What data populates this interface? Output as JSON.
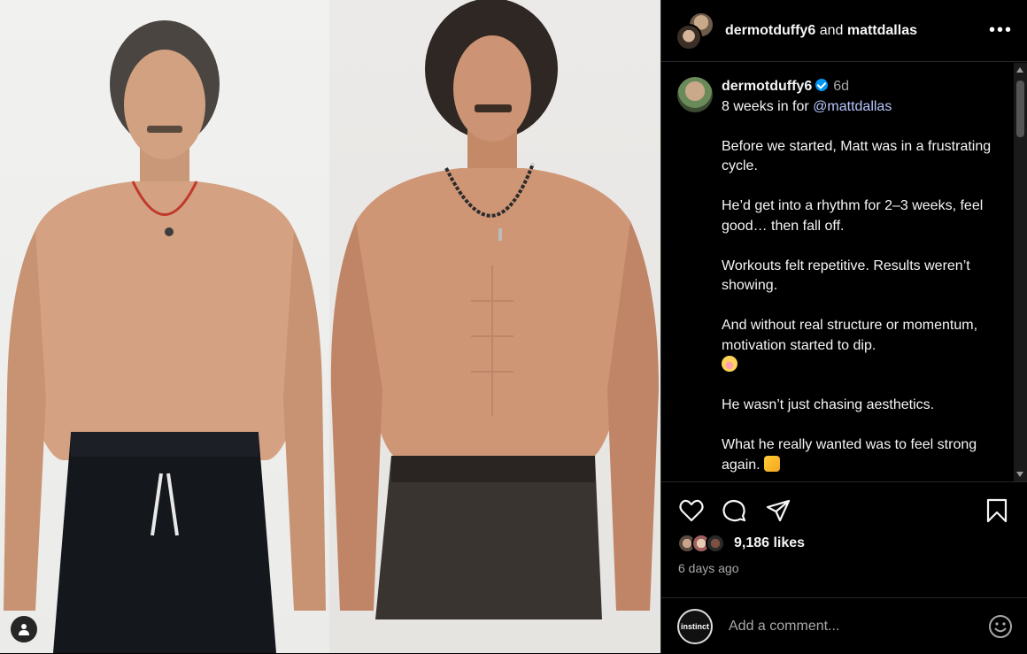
{
  "header": {
    "user1": "dermotduffy6",
    "and": "and",
    "user2": "mattdallas",
    "more": "•••"
  },
  "caption": {
    "username": "dermotduffy6",
    "time": "6d",
    "line1_prefix": "8 weeks in for ",
    "mention": "@mattdallas",
    "paragraphs": [
      "Before we started, Matt was in a frustrating cycle.",
      "He’d get into a rhythm for 2–3 weeks, feel good… then fall off.",
      "Workouts felt repetitive. Results weren’t showing.",
      "And without real structure or momentum, motivation started to dip.",
      "He wasn’t just chasing aesthetics.",
      "What he really wanted was to feel strong again."
    ]
  },
  "actions": {
    "icons": [
      "heart-icon",
      "comment-icon",
      "share-icon",
      "bookmark-icon"
    ]
  },
  "likes": {
    "count": "9,186 likes"
  },
  "posted": "6 days ago",
  "comment": {
    "avatar_text": "instinct",
    "placeholder": "Add a comment..."
  },
  "colors": {
    "background": "#000000",
    "border": "#262626",
    "verified": "#0095f6",
    "muted": "#a8a8a8"
  }
}
